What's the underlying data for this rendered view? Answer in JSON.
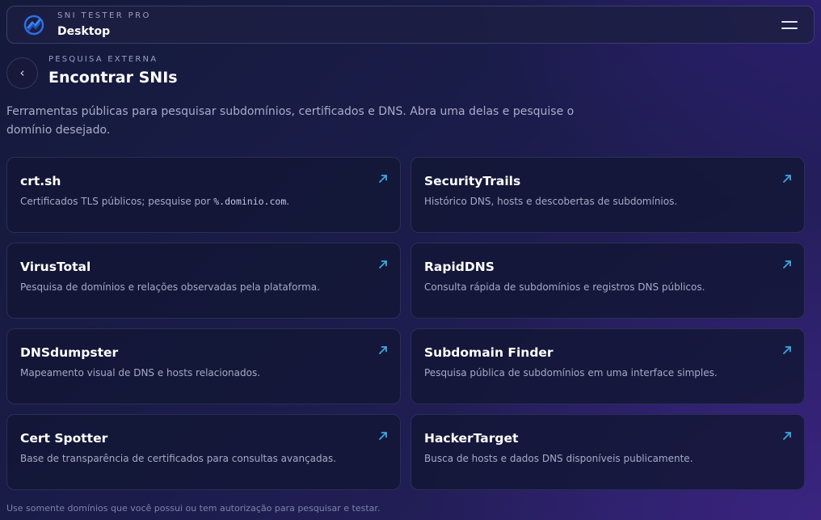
{
  "header": {
    "app_name": "SNI TESTER PRO",
    "app_sub": "Desktop"
  },
  "page": {
    "eyebrow": "PESQUISA EXTERNA",
    "title": "Encontrar SNIs",
    "back_label": "‹",
    "intro": "Ferramentas públicas para pesquisar subdomínios, certificados e DNS. Abra uma delas e pesquise o domínio desejado."
  },
  "tools": [
    {
      "title": "crt.sh",
      "desc_before": "Certificados TLS públicos; pesquise por ",
      "desc_code": "%.dominio.com",
      "desc_after": "."
    },
    {
      "title": "SecurityTrails",
      "desc_before": "Histórico DNS, hosts e descobertas de subdomínios.",
      "desc_code": "",
      "desc_after": ""
    },
    {
      "title": "VirusTotal",
      "desc_before": "Pesquisa de domínios e relações observadas pela plataforma.",
      "desc_code": "",
      "desc_after": ""
    },
    {
      "title": "RapidDNS",
      "desc_before": "Consulta rápida de subdomínios e registros DNS públicos.",
      "desc_code": "",
      "desc_after": ""
    },
    {
      "title": "DNSdumpster",
      "desc_before": "Mapeamento visual de DNS e hosts relacionados.",
      "desc_code": "",
      "desc_after": ""
    },
    {
      "title": "Subdomain Finder",
      "desc_before": "Pesquisa pública de subdomínios em uma interface simples.",
      "desc_code": "",
      "desc_after": ""
    },
    {
      "title": "Cert Spotter",
      "desc_before": "Base de transparência de certificados para consultas avançadas.",
      "desc_code": "",
      "desc_after": ""
    },
    {
      "title": "HackerTarget",
      "desc_before": "Busca de hosts e dados DNS disponíveis publicamente.",
      "desc_code": "",
      "desc_after": ""
    }
  ],
  "footer": {
    "note": "Use somente domínios que você possui ou tem autorização para pesquisar e testar."
  },
  "icons": {
    "logo": "logo-icon",
    "menu": "hamburger-menu-icon",
    "external": "external-link-arrow-icon"
  },
  "colors": {
    "accent": "#3aa8e0",
    "logo_blue": "#2e6fe0"
  }
}
